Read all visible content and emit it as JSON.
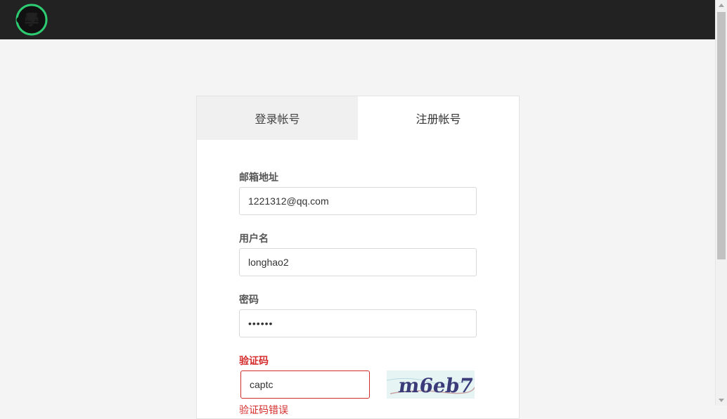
{
  "header": {
    "logo_text": "學"
  },
  "tabs": [
    {
      "label": "登录帐号",
      "active": false
    },
    {
      "label": "注册帐号",
      "active": true
    }
  ],
  "form": {
    "email": {
      "label": "邮箱地址",
      "value": "1221312@qq.com"
    },
    "username": {
      "label": "用户名",
      "value": "longhao2"
    },
    "password": {
      "label": "密码",
      "value": "123456"
    },
    "captcha": {
      "label": "验证码",
      "value": "captc",
      "image_text": "m6eb7",
      "error": "验证码错误"
    }
  },
  "colors": {
    "topbar": "#222222",
    "logo_ring": "#2ecc71",
    "error": "#d52b2b",
    "page_bg": "#f4f4f4"
  }
}
